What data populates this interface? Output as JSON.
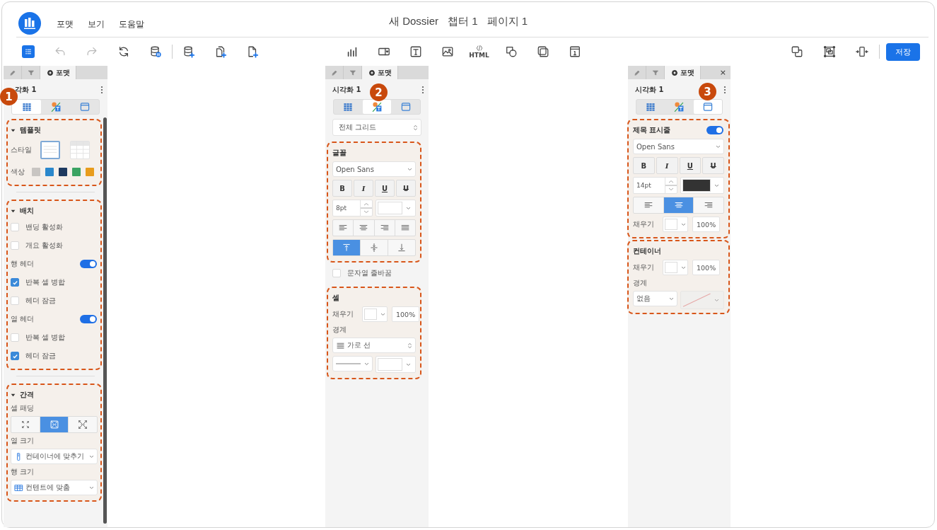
{
  "menu": [
    {
      "label": "포맷"
    },
    {
      "label": "보기"
    },
    {
      "label": "도움말"
    }
  ],
  "title": [
    "새 Dossier",
    "챕터 1",
    "페이지 1"
  ],
  "toolbar": {
    "groups": [
      [
        {
          "kind": "list",
          "selected": true,
          "disabled": false
        },
        {
          "kind": "undo",
          "selected": false,
          "disabled": true
        },
        {
          "kind": "redo",
          "selected": false,
          "disabled": true
        },
        {
          "kind": "refresh",
          "selected": false,
          "disabled": false
        },
        {
          "kind": "data-pause",
          "selected": false,
          "disabled": false
        }
      ],
      [
        {
          "kind": "data-add",
          "selected": false,
          "disabled": false
        },
        {
          "kind": "copy-add",
          "selected": false,
          "disabled": false
        },
        {
          "kind": "page-add",
          "selected": false,
          "disabled": false
        }
      ]
    ],
    "insert": [
      {
        "kind": "bar-chart"
      },
      {
        "kind": "dropdown"
      },
      {
        "kind": "text"
      },
      {
        "kind": "image"
      },
      {
        "kind": "html",
        "label": "HTML"
      },
      {
        "kind": "shape"
      },
      {
        "kind": "stack"
      },
      {
        "kind": "info"
      }
    ],
    "arrange": [
      {
        "kind": "overlap"
      },
      {
        "kind": "frame"
      },
      {
        "kind": "fit-width"
      }
    ],
    "save": "저장"
  },
  "panels": [
    {
      "tabs": [
        {
          "kind": "edit",
          "selected": false
        },
        {
          "kind": "filter",
          "selected": false
        },
        {
          "kind": "format",
          "label": "포맷",
          "selected": true
        }
      ],
      "title": "각화 1",
      "badge": "1",
      "views": [
        {
          "kind": "grid",
          "selected": true
        },
        {
          "kind": "text-format",
          "selected": false
        },
        {
          "kind": "title-bar",
          "selected": false
        }
      ],
      "blocks": [
        {
          "kind": "section",
          "rows": [
            {
              "kind": "heading",
              "label": "템플릿",
              "expanded": true
            },
            {
              "kind": "style-picker",
              "label": "스타일",
              "options": [
                {
                  "kind": "lines",
                  "selected": true
                },
                {
                  "kind": "grid",
                  "selected": false
                }
              ]
            },
            {
              "kind": "swatches",
              "label": "색상",
              "colors": [
                {
                  "color": "#c8c5c2"
                },
                {
                  "color": "#2b88cc"
                },
                {
                  "color": "#1e3a60"
                },
                {
                  "color": "#3ba363"
                },
                {
                  "color": "#e89c1c"
                }
              ]
            }
          ]
        },
        {
          "kind": "section",
          "rows": [
            {
              "kind": "heading",
              "label": "배치",
              "expanded": true
            },
            {
              "kind": "checkbox",
              "label": "밴딩 활성화",
              "checked": false
            },
            {
              "kind": "checkbox",
              "label": "개요 활성화",
              "checked": false
            },
            {
              "kind": "toggle",
              "label": "행 헤더",
              "on": true
            },
            {
              "kind": "checkbox",
              "label": "반복 셀 병합",
              "checked": true
            },
            {
              "kind": "checkbox",
              "label": "헤더 잠금",
              "checked": false
            },
            {
              "kind": "toggle",
              "label": "열 헤더",
              "on": true
            },
            {
              "kind": "checkbox",
              "label": "반복 셀 병합",
              "checked": false
            },
            {
              "kind": "checkbox",
              "label": "헤더 잠금",
              "checked": true
            }
          ]
        },
        {
          "kind": "section",
          "rows": [
            {
              "kind": "heading",
              "label": "간격",
              "expanded": true
            },
            {
              "kind": "label",
              "label": "셀 패딩"
            },
            {
              "kind": "segmented",
              "options": [
                {
                  "kind": "pad-small",
                  "selected": false
                },
                {
                  "kind": "pad-medium",
                  "selected": true
                },
                {
                  "kind": "pad-large",
                  "selected": false
                }
              ]
            },
            {
              "kind": "label",
              "label": "열 크기"
            },
            {
              "kind": "column-dropdown",
              "value": "컨테이너에 맞추기"
            },
            {
              "kind": "label",
              "label": "행 크기"
            },
            {
              "kind": "table-dropdown",
              "value": "컨텐트에 맞춤"
            }
          ]
        }
      ]
    },
    {
      "tabs": [
        {
          "kind": "edit",
          "selected": false
        },
        {
          "kind": "filter",
          "selected": false
        },
        {
          "kind": "format",
          "label": "포맷",
          "selected": true
        }
      ],
      "title": "시각화 1",
      "badge": "2",
      "views": [
        {
          "kind": "grid",
          "selected": false
        },
        {
          "kind": "text-format",
          "selected": true
        },
        {
          "kind": "title-bar",
          "selected": false
        }
      ],
      "blocks": [
        {
          "kind": "spinner-dropdown",
          "value": "전체 그리드"
        },
        {
          "kind": "section",
          "rows": [
            {
              "kind": "heading",
              "label": "글꼴"
            },
            {
              "kind": "dropdown",
              "value": "Open Sans"
            },
            {
              "kind": "text-style",
              "buttons": [
                {
                  "kind": "bold",
                  "label": "B"
                },
                {
                  "kind": "italic",
                  "label": "I"
                },
                {
                  "kind": "underline",
                  "label": "U"
                },
                {
                  "kind": "strike",
                  "label": "U"
                }
              ]
            },
            {
              "kind": "size-color",
              "size": "8pt",
              "color": "#ffffff"
            },
            {
              "kind": "align",
              "options": [
                {
                  "kind": "left",
                  "selected": false
                },
                {
                  "kind": "center",
                  "selected": false
                },
                {
                  "kind": "right",
                  "selected": false
                },
                {
                  "kind": "justify",
                  "selected": false
                }
              ]
            },
            {
              "kind": "align",
              "options": [
                {
                  "kind": "top",
                  "selected": true
                },
                {
                  "kind": "middle",
                  "selected": false
                },
                {
                  "kind": "bottom",
                  "selected": false
                }
              ]
            }
          ]
        },
        {
          "kind": "checkbox",
          "label": "문자열 줄바꿈",
          "checked": false
        },
        {
          "kind": "section",
          "rows": [
            {
              "kind": "heading",
              "label": "셀"
            },
            {
              "kind": "fill",
              "label": "채우기",
              "color": "#ffffff",
              "opacity": "100%"
            },
            {
              "kind": "label",
              "label": "경계"
            },
            {
              "kind": "lines-dropdown",
              "value": "가로 선"
            },
            {
              "kind": "line-border-row",
              "color": "#ffffff",
              "disabled": false
            }
          ]
        }
      ]
    },
    {
      "tabs": [
        {
          "kind": "edit",
          "selected": false
        },
        {
          "kind": "filter",
          "selected": false
        },
        {
          "kind": "format",
          "label": "포맷",
          "selected": true
        }
      ],
      "close": "×",
      "title": "시각화 1",
      "badge": "3",
      "views": [
        {
          "kind": "grid",
          "selected": false
        },
        {
          "kind": "text-format",
          "selected": false
        },
        {
          "kind": "title-bar",
          "selected": true
        }
      ],
      "blocks": [
        {
          "kind": "section",
          "rows": [
            {
              "kind": "heading",
              "label": "제목 표시줄",
              "on": true
            },
            {
              "kind": "dropdown",
              "value": "Open Sans"
            },
            {
              "kind": "text-style",
              "buttons": [
                {
                  "kind": "bold",
                  "label": "B"
                },
                {
                  "kind": "italic",
                  "label": "I"
                },
                {
                  "kind": "underline",
                  "label": "U"
                },
                {
                  "kind": "strike",
                  "label": "U"
                }
              ]
            },
            {
              "kind": "size-color",
              "size": "14pt",
              "color": "#333333"
            },
            {
              "kind": "align",
              "options": [
                {
                  "kind": "left",
                  "selected": false
                },
                {
                  "kind": "center",
                  "selected": true
                },
                {
                  "kind": "right",
                  "selected": false
                }
              ]
            },
            {
              "kind": "fill",
              "label": "채우기",
              "color": "#ffffff",
              "opacity": "100%"
            }
          ]
        },
        {
          "kind": "section",
          "rows": [
            {
              "kind": "heading",
              "label": "컨테이너"
            },
            {
              "kind": "fill",
              "label": "채우기",
              "color": "#ffffff",
              "opacity": "100%"
            },
            {
              "kind": "label",
              "label": "경계"
            },
            {
              "kind": "border-row",
              "value": "없음",
              "disabled": true
            }
          ]
        }
      ]
    }
  ]
}
